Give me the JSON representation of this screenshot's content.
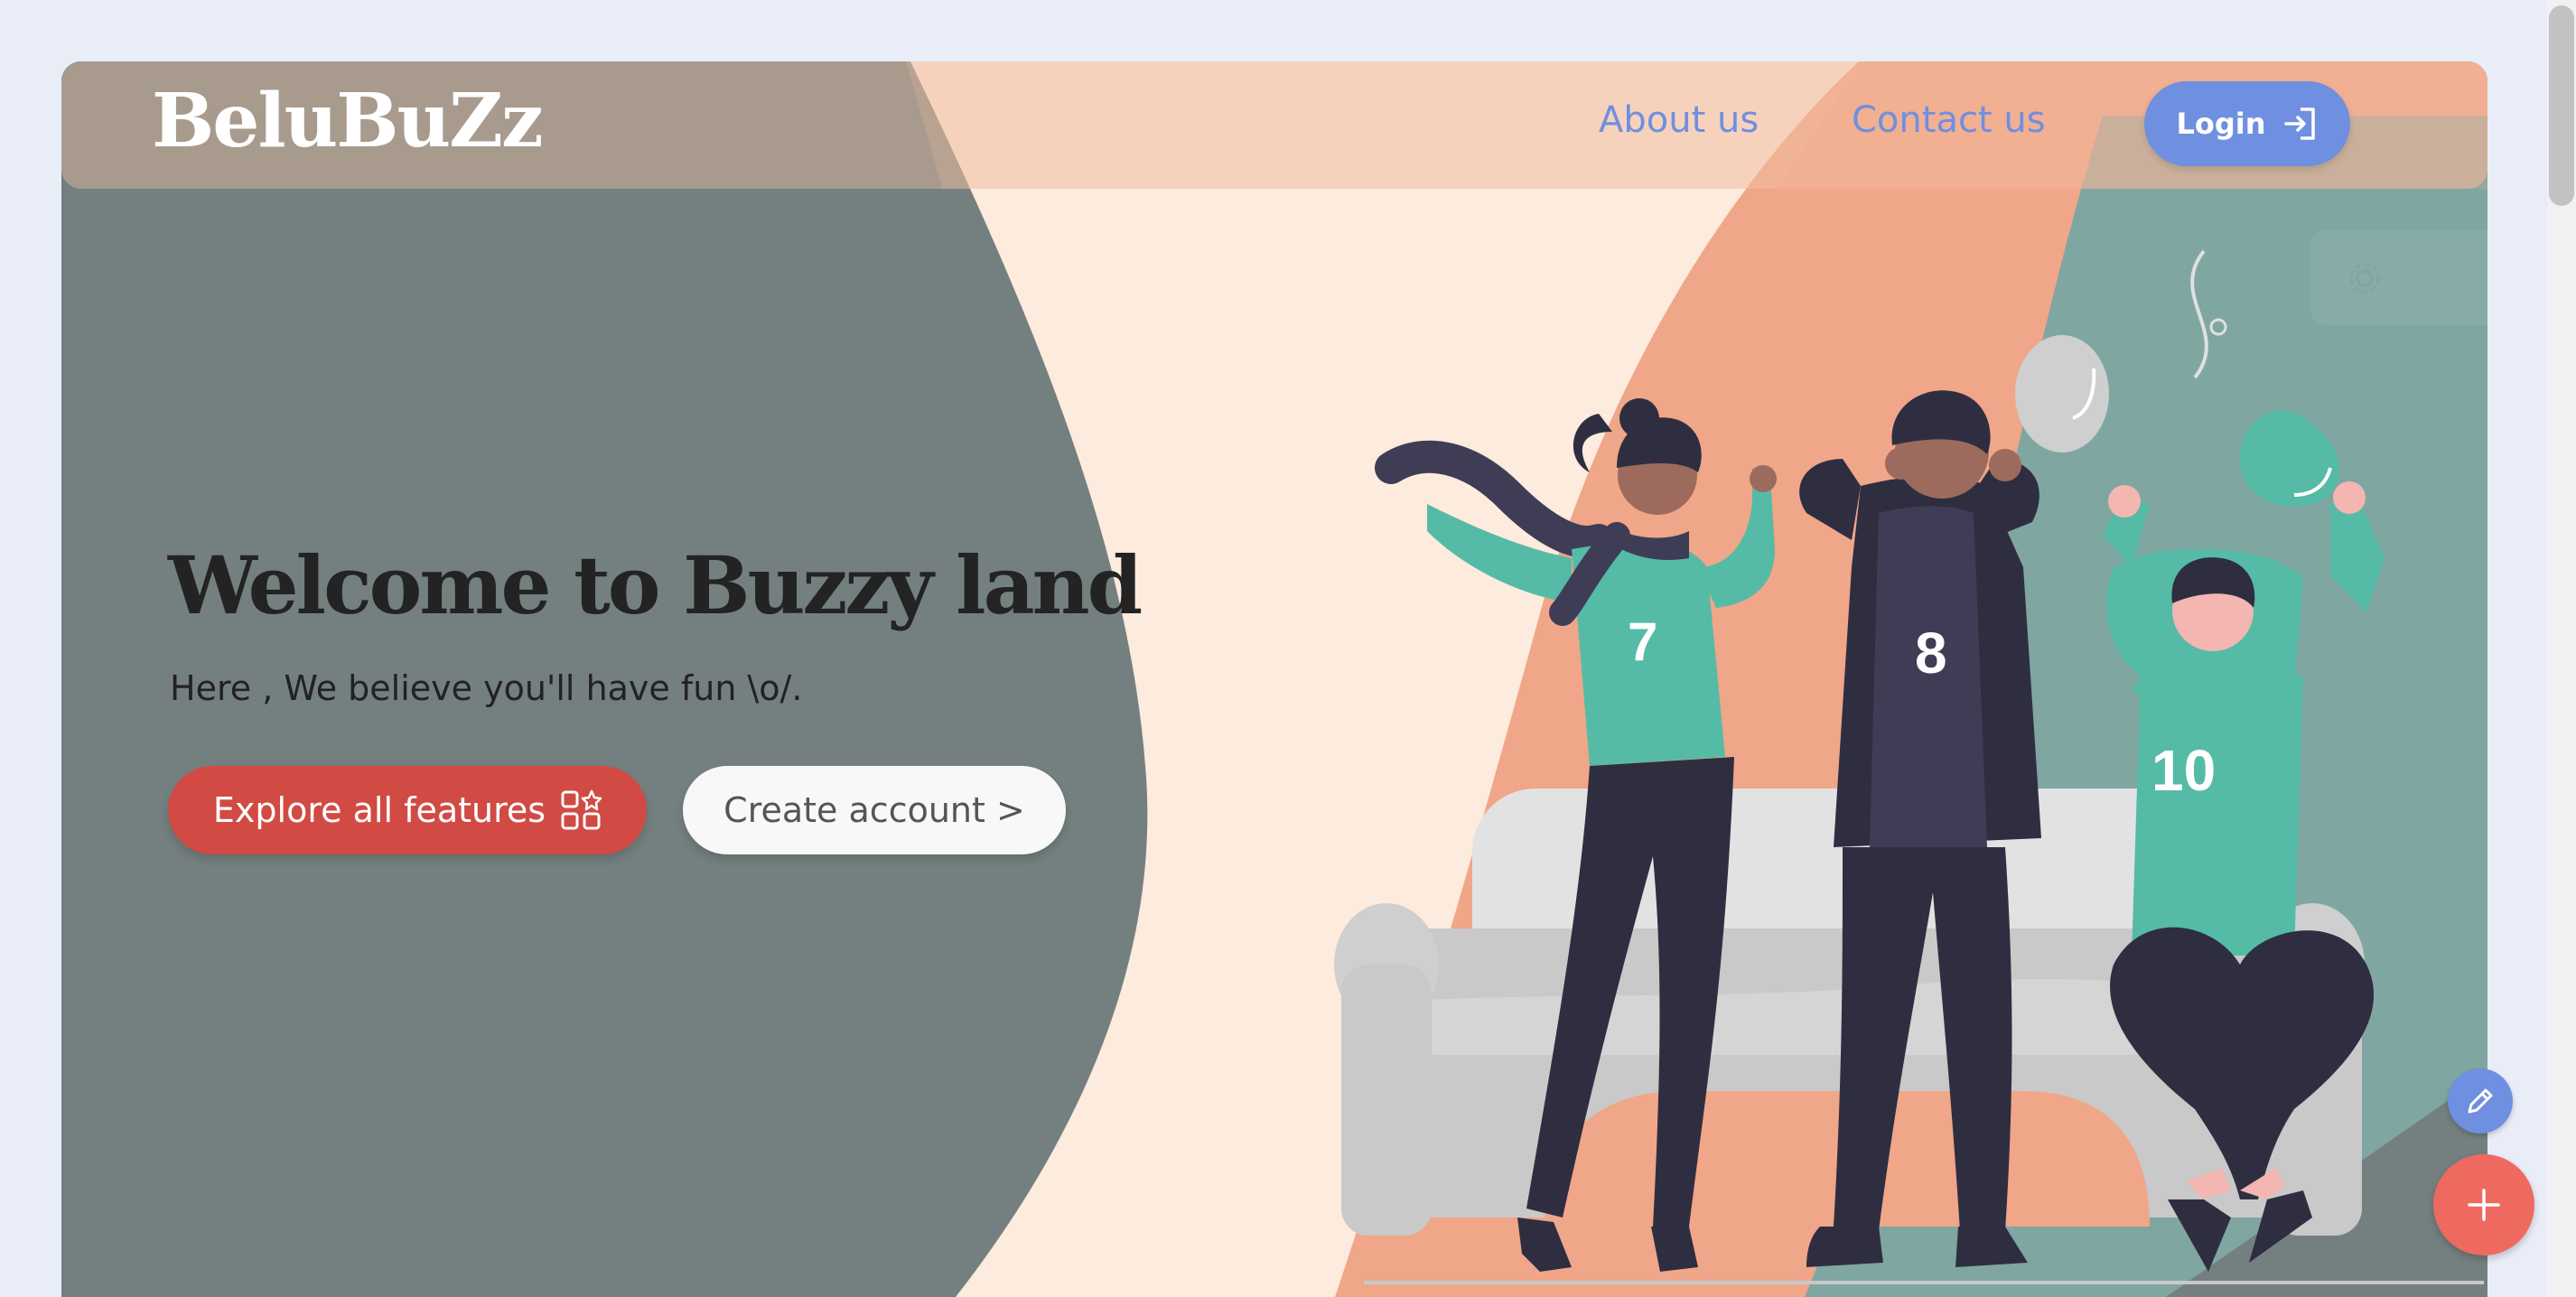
{
  "nav": {
    "logo": "BeluBuZz",
    "about_label": "About us",
    "contact_label": "Contact us",
    "login_label": "Login"
  },
  "hero": {
    "title": "Welcome to Buzzy land",
    "subtitle": "Here , We believe you'll have fun \\o/.",
    "explore_label": "Explore all features",
    "create_label": "Create account >"
  },
  "illustration": {
    "jersey_left": "7",
    "jersey_middle": "8",
    "jersey_right": "10"
  },
  "colors": {
    "accent_blue": "#6f8fe0",
    "accent_red": "#d24a44",
    "fab_red": "#ee6a61",
    "teal": "#55bba6",
    "dark": "#2f2e41",
    "sand": "#fdebdd",
    "salmon": "#f0a688"
  },
  "icons": {
    "login": "login-arrow-icon",
    "explore": "grid-star-icon",
    "edit": "pencil-icon",
    "add": "plus-icon"
  }
}
